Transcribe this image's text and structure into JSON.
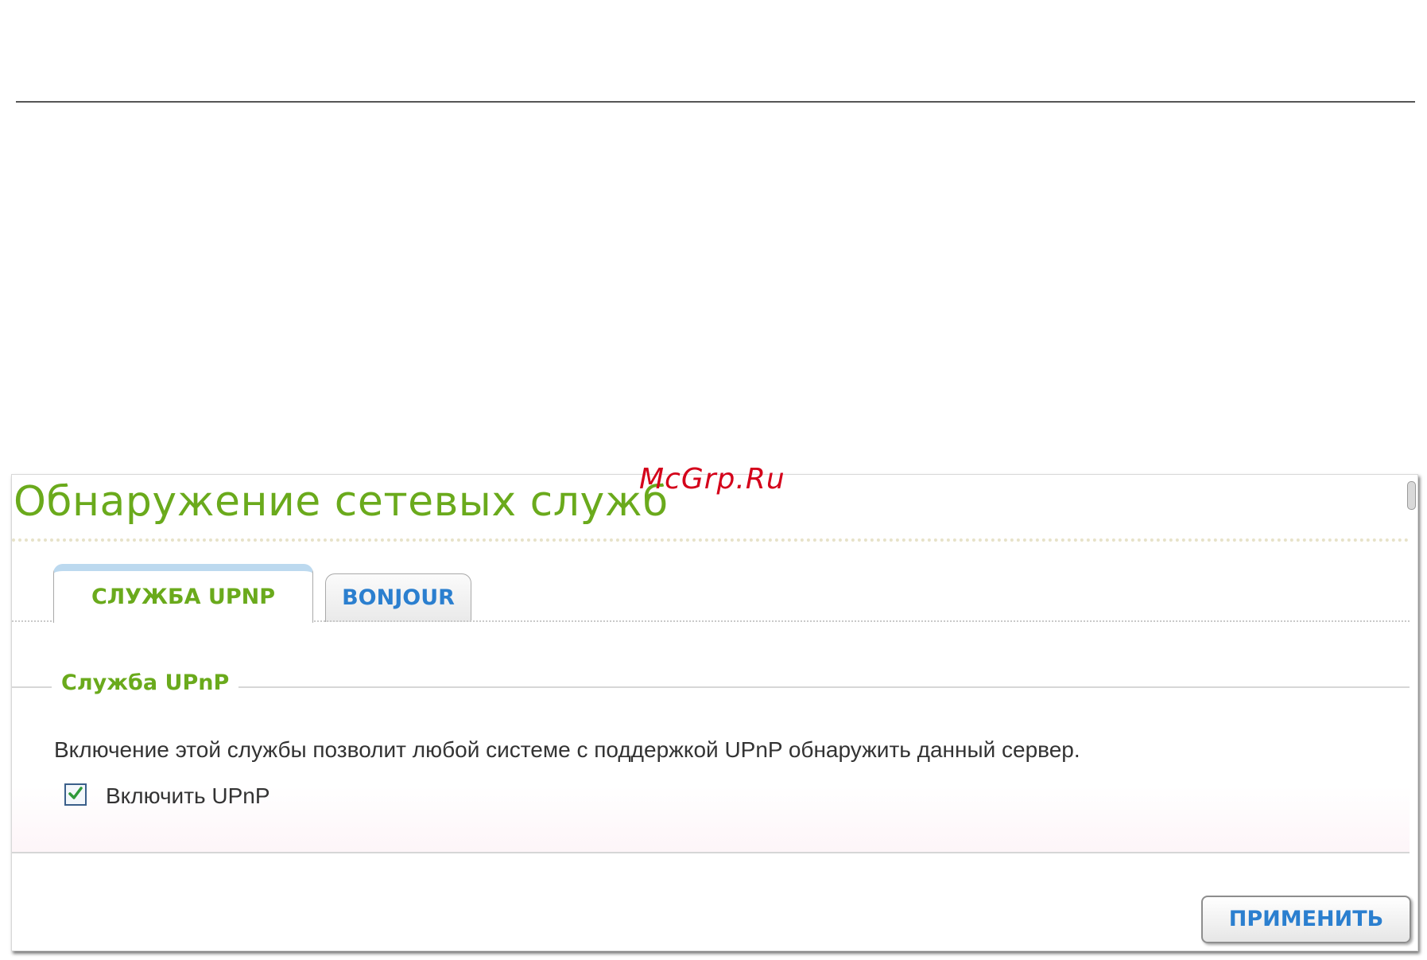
{
  "watermark": "McGrp.Ru",
  "page": {
    "title": "Обнаружение сетевых служб"
  },
  "tabs": [
    {
      "label": "СЛУЖБА UPNP",
      "active": true
    },
    {
      "label": "BONJOUR",
      "active": false
    }
  ],
  "upnp_section": {
    "legend": "Служба UPnP",
    "description": "Включение этой службы позволит любой системе с поддержкой UPnP обнаружить данный сервер.",
    "enable_checkbox": {
      "label": "Включить UPnP",
      "checked": true
    }
  },
  "apply_button_label": "ПРИМЕНИТЬ",
  "colors": {
    "title_green": "#6aaa1c",
    "link_blue": "#2b7fcf",
    "watermark_red": "#d4001a"
  },
  "icons": {
    "checkbox": "check-icon"
  }
}
